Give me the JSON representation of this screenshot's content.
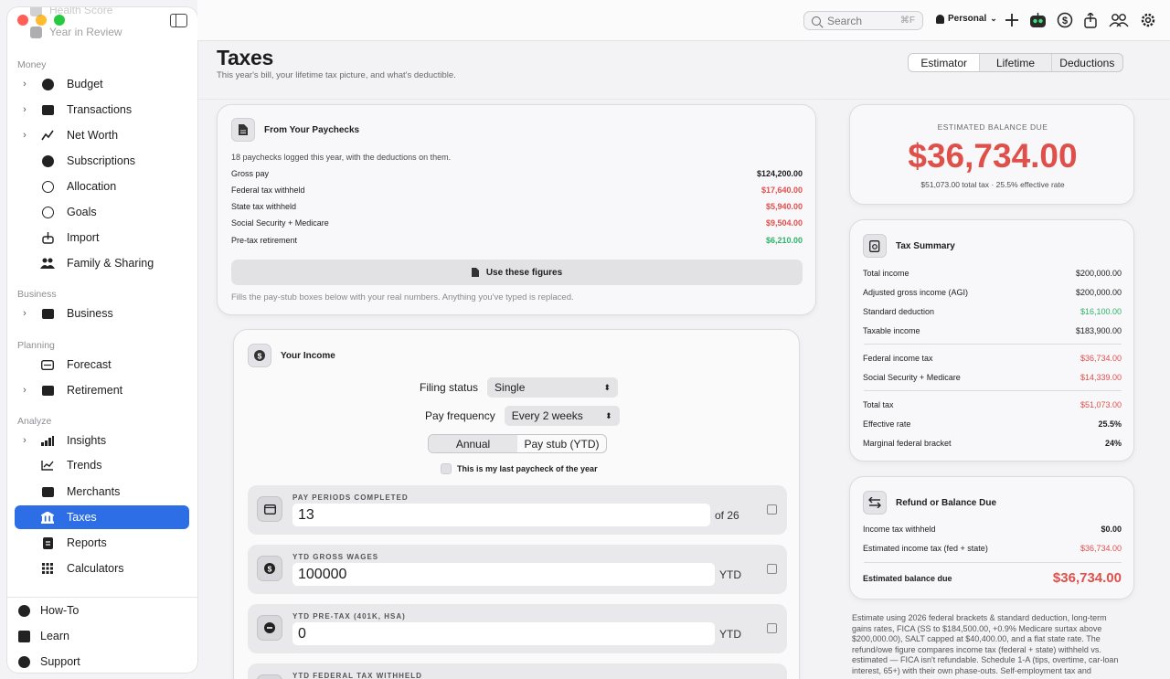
{
  "sidebar": {
    "ghost_items": [
      "Health Score",
      "Year in Review"
    ],
    "sections": [
      {
        "title": "Money"
      },
      {
        "title": "Business"
      },
      {
        "title": "Planning"
      },
      {
        "title": "Analyze"
      }
    ],
    "items": [
      {
        "label": "Budget",
        "icon": "pie-chart-icon",
        "chevron": true
      },
      {
        "label": "Transactions",
        "icon": "list-icon",
        "chevron": true
      },
      {
        "label": "Net Worth",
        "icon": "line-chart-icon",
        "chevron": true
      },
      {
        "label": "Subscriptions",
        "icon": "repeat-icon",
        "chevron": false
      },
      {
        "label": "Allocation",
        "icon": "clock-icon",
        "chevron": false
      },
      {
        "label": "Goals",
        "icon": "target-icon",
        "chevron": false
      },
      {
        "label": "Import",
        "icon": "import-icon",
        "chevron": false
      },
      {
        "label": "Family & Sharing",
        "icon": "people-icon",
        "chevron": false
      },
      {
        "label": "Business",
        "icon": "briefcase-icon",
        "chevron": true
      },
      {
        "label": "Forecast",
        "icon": "forecast-icon",
        "chevron": false
      },
      {
        "label": "Retirement",
        "icon": "map-icon",
        "chevron": true
      },
      {
        "label": "Insights",
        "icon": "bars-icon",
        "chevron": true
      },
      {
        "label": "Trends",
        "icon": "trend-icon",
        "chevron": false
      },
      {
        "label": "Merchants",
        "icon": "store-icon",
        "chevron": false
      },
      {
        "label": "Taxes",
        "icon": "bank-icon",
        "chevron": false,
        "active": true
      },
      {
        "label": "Reports",
        "icon": "report-icon",
        "chevron": false
      },
      {
        "label": "Calculators",
        "icon": "calculator-icon",
        "chevron": false
      }
    ],
    "bottom": [
      {
        "label": "How-To",
        "icon": "question-icon"
      },
      {
        "label": "Learn",
        "icon": "book-icon"
      },
      {
        "label": "Support",
        "icon": "lifebuoy-icon"
      }
    ]
  },
  "toolbar": {
    "search_placeholder": "Search",
    "search_shortcut": "⌘F",
    "profile": "Personal"
  },
  "page": {
    "title": "Taxes",
    "subtitle": "This year's bill, your lifetime tax picture, and what's deductible.",
    "tabs": [
      "Estimator",
      "Lifetime",
      "Deductions"
    ],
    "active_tab": "Estimator"
  },
  "paychecks": {
    "title": "From Your Paychecks",
    "intro": "18 paychecks logged this year, with the deductions on them.",
    "rows": [
      {
        "label": "Gross pay",
        "value": "$124,200.00",
        "tone": "normal"
      },
      {
        "label": "Federal tax withheld",
        "value": "$17,640.00",
        "tone": "red"
      },
      {
        "label": "State tax withheld",
        "value": "$5,940.00",
        "tone": "red"
      },
      {
        "label": "Social Security + Medicare",
        "value": "$9,504.00",
        "tone": "red"
      },
      {
        "label": "Pre-tax retirement",
        "value": "$6,210.00",
        "tone": "green"
      }
    ],
    "button": "Use these figures",
    "note": "Fills the pay-stub boxes below with your real numbers. Anything you've typed is replaced."
  },
  "income": {
    "title": "Your Income",
    "filing_label": "Filing status",
    "filing_value": "Single",
    "frequency_label": "Pay frequency",
    "frequency_value": "Every 2 weeks",
    "mode_options": [
      "Annual",
      "Pay stub (YTD)"
    ],
    "mode_selected": "Pay stub (YTD)",
    "last_paycheck_label": "This is my last paycheck of the year",
    "fields": [
      {
        "label": "PAY PERIODS COMPLETED",
        "value": "13",
        "suffix": "of 26"
      },
      {
        "label": "YTD GROSS WAGES",
        "value": "100000",
        "suffix": "YTD"
      },
      {
        "label": "YTD PRE-TAX (401K, HSA)",
        "value": "0",
        "suffix": "YTD"
      },
      {
        "label": "YTD FEDERAL TAX WITHHELD",
        "value": "",
        "suffix": ""
      }
    ]
  },
  "balance": {
    "caption": "ESTIMATED BALANCE DUE",
    "amount": "$36,734.00",
    "detail": "$51,073.00 total tax · 25.5% effective rate"
  },
  "summary": {
    "title": "Tax Summary",
    "groups": [
      [
        {
          "label": "Total income",
          "value": "$200,000.00",
          "tone": "normal"
        },
        {
          "label": "Adjusted gross income (AGI)",
          "value": "$200,000.00",
          "tone": "normal"
        },
        {
          "label": "Standard deduction",
          "value": "$16,100.00",
          "tone": "green"
        },
        {
          "label": "Taxable income",
          "value": "$183,900.00",
          "tone": "normal"
        }
      ],
      [
        {
          "label": "Federal income tax",
          "value": "$36,734.00",
          "tone": "red"
        },
        {
          "label": "Social Security + Medicare",
          "value": "$14,339.00",
          "tone": "red"
        }
      ],
      [
        {
          "label": "Total tax",
          "value": "$51,073.00",
          "tone": "red"
        },
        {
          "label": "Effective rate",
          "value": "25.5%",
          "tone": "bold"
        },
        {
          "label": "Marginal federal bracket",
          "value": "24%",
          "tone": "bold"
        }
      ]
    ]
  },
  "refund": {
    "title": "Refund or Balance Due",
    "rows": [
      {
        "label": "Income tax withheld",
        "value": "$0.00",
        "tone": "bold"
      },
      {
        "label": "Estimated income tax (fed + state)",
        "value": "$36,734.00",
        "tone": "red"
      }
    ],
    "total_label": "Estimated balance due",
    "total_value": "$36,734.00"
  },
  "footnote": "Estimate using 2026 federal brackets & standard deduction, long-term gains rates, FICA (SS to $184,500.00, +0.9% Medicare surtax above $200,000.00), SALT capped at $40,400.00, and a flat state rate. The refund/owe figure compares income tax (federal + state) withheld vs. estimated — FICA isn't refundable. Schedule 1-A (tips, overtime, car-loan interest, 65+) with their own phase-outs. Self-employment tax and"
}
